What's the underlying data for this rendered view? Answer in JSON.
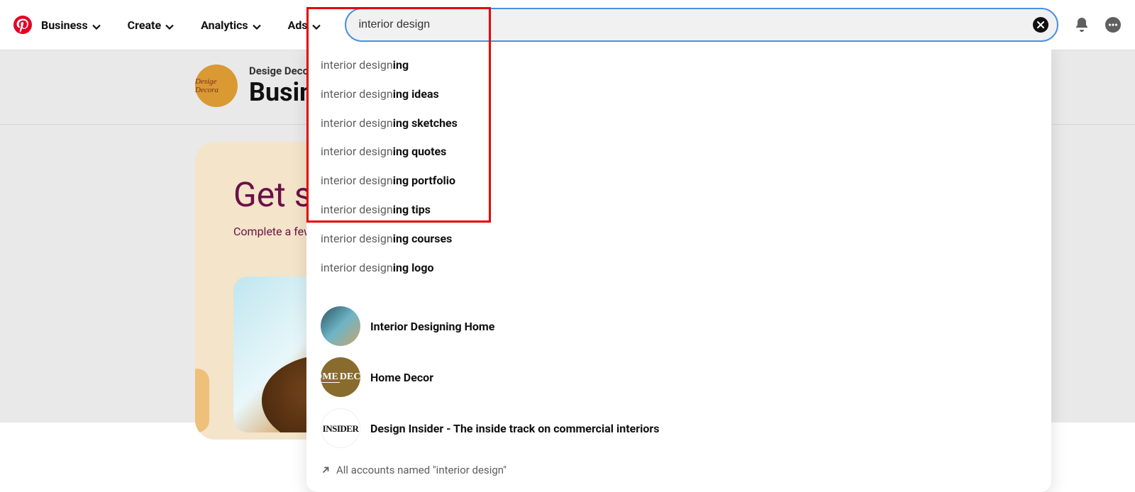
{
  "nav": {
    "items": [
      "Business",
      "Create",
      "Analytics",
      "Ads"
    ]
  },
  "search": {
    "value": "interior design"
  },
  "profile": {
    "avatar_text": "Desige Decora",
    "name": "Desige Decora",
    "type_prefix": "Busin"
  },
  "card": {
    "title_prefix": "Get st",
    "subtitle_prefix": "Complete a few ta"
  },
  "suggestions": [
    {
      "prefix": "interior design",
      "suffix": "ing"
    },
    {
      "prefix": "interior design",
      "suffix": "ing ideas"
    },
    {
      "prefix": "interior design",
      "suffix": "ing sketches"
    },
    {
      "prefix": "interior design",
      "suffix": "ing quotes"
    },
    {
      "prefix": "interior design",
      "suffix": "ing portfolio"
    },
    {
      "prefix": "interior design",
      "suffix": "ing tips"
    },
    {
      "prefix": "interior design",
      "suffix": "ing courses"
    },
    {
      "prefix": "interior design",
      "suffix": "ing logo"
    }
  ],
  "accounts": [
    {
      "name": "Interior Designing Home",
      "avatar_style": "photo"
    },
    {
      "name": "Home Decor",
      "avatar_style": "home"
    },
    {
      "name": "Design Insider - The inside track on commercial interiors",
      "avatar_style": "insider",
      "avatar_text": "INSIDER"
    }
  ],
  "all_accounts_label": "All accounts named \"interior design\"",
  "home_decor_avatar_top": "HOME",
  "home_decor_avatar_bottom": "DECOR"
}
